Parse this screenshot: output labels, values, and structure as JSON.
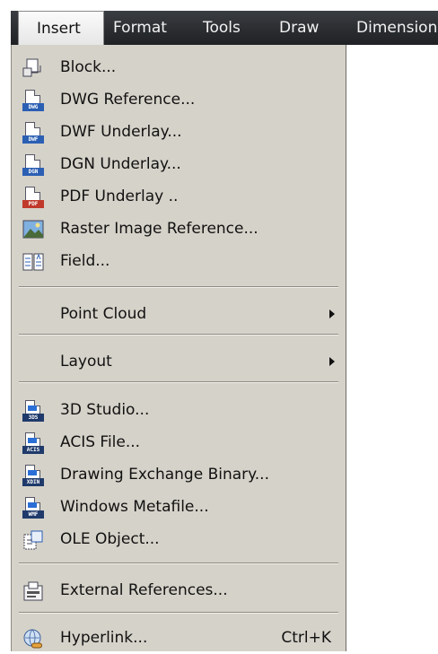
{
  "menubar": {
    "items": [
      "Insert",
      "Format",
      "Tools",
      "Draw",
      "Dimension"
    ]
  },
  "menu": {
    "block": "Block...",
    "dwg_reference": "DWG Reference...",
    "dwf_underlay": "DWF Underlay...",
    "dgn_underlay": "DGN Underlay...",
    "pdf_underlay": "PDF Underlay ..",
    "raster_image_reference": "Raster Image Reference...",
    "field": "Field...",
    "point_cloud": "Point Cloud",
    "layout": "Layout",
    "studio_3d": "3D Studio...",
    "acis_file": "ACIS File...",
    "drawing_exchange_binary": "Drawing Exchange Binary...",
    "windows_metafile": "Windows Metafile...",
    "ole_object": "OLE Object...",
    "external_references": "External References...",
    "hyperlink": "Hyperlink...",
    "hyperlink_shortcut": "Ctrl+K"
  },
  "icon_tags": {
    "dwg": "DWG",
    "dwf": "DWF",
    "dgn": "DGN",
    "pdf": "PDF",
    "studio_3d": "3DS",
    "acis": "ACIS",
    "dxb": "XDIN",
    "wmf": "WMF"
  },
  "icons": {
    "block": "block-icon",
    "dwg": "dwg-reference-icon",
    "dwf": "dwf-underlay-icon",
    "dgn": "dgn-underlay-icon",
    "pdf": "pdf-underlay-icon",
    "raster": "raster-image-icon",
    "field": "field-icon",
    "studio_3d": "3d-studio-icon",
    "acis": "acis-file-icon",
    "dxb": "drawing-exchange-binary-icon",
    "wmf": "windows-metafile-icon",
    "ole": "ole-object-icon",
    "xref": "external-references-icon",
    "hyperlink": "hyperlink-icon"
  },
  "colors": {
    "menu_bg": "#d5d2c9",
    "menubar_bg": "#2b2d30",
    "pdf_red": "#c0392b",
    "blue": "#2b5fb3"
  }
}
